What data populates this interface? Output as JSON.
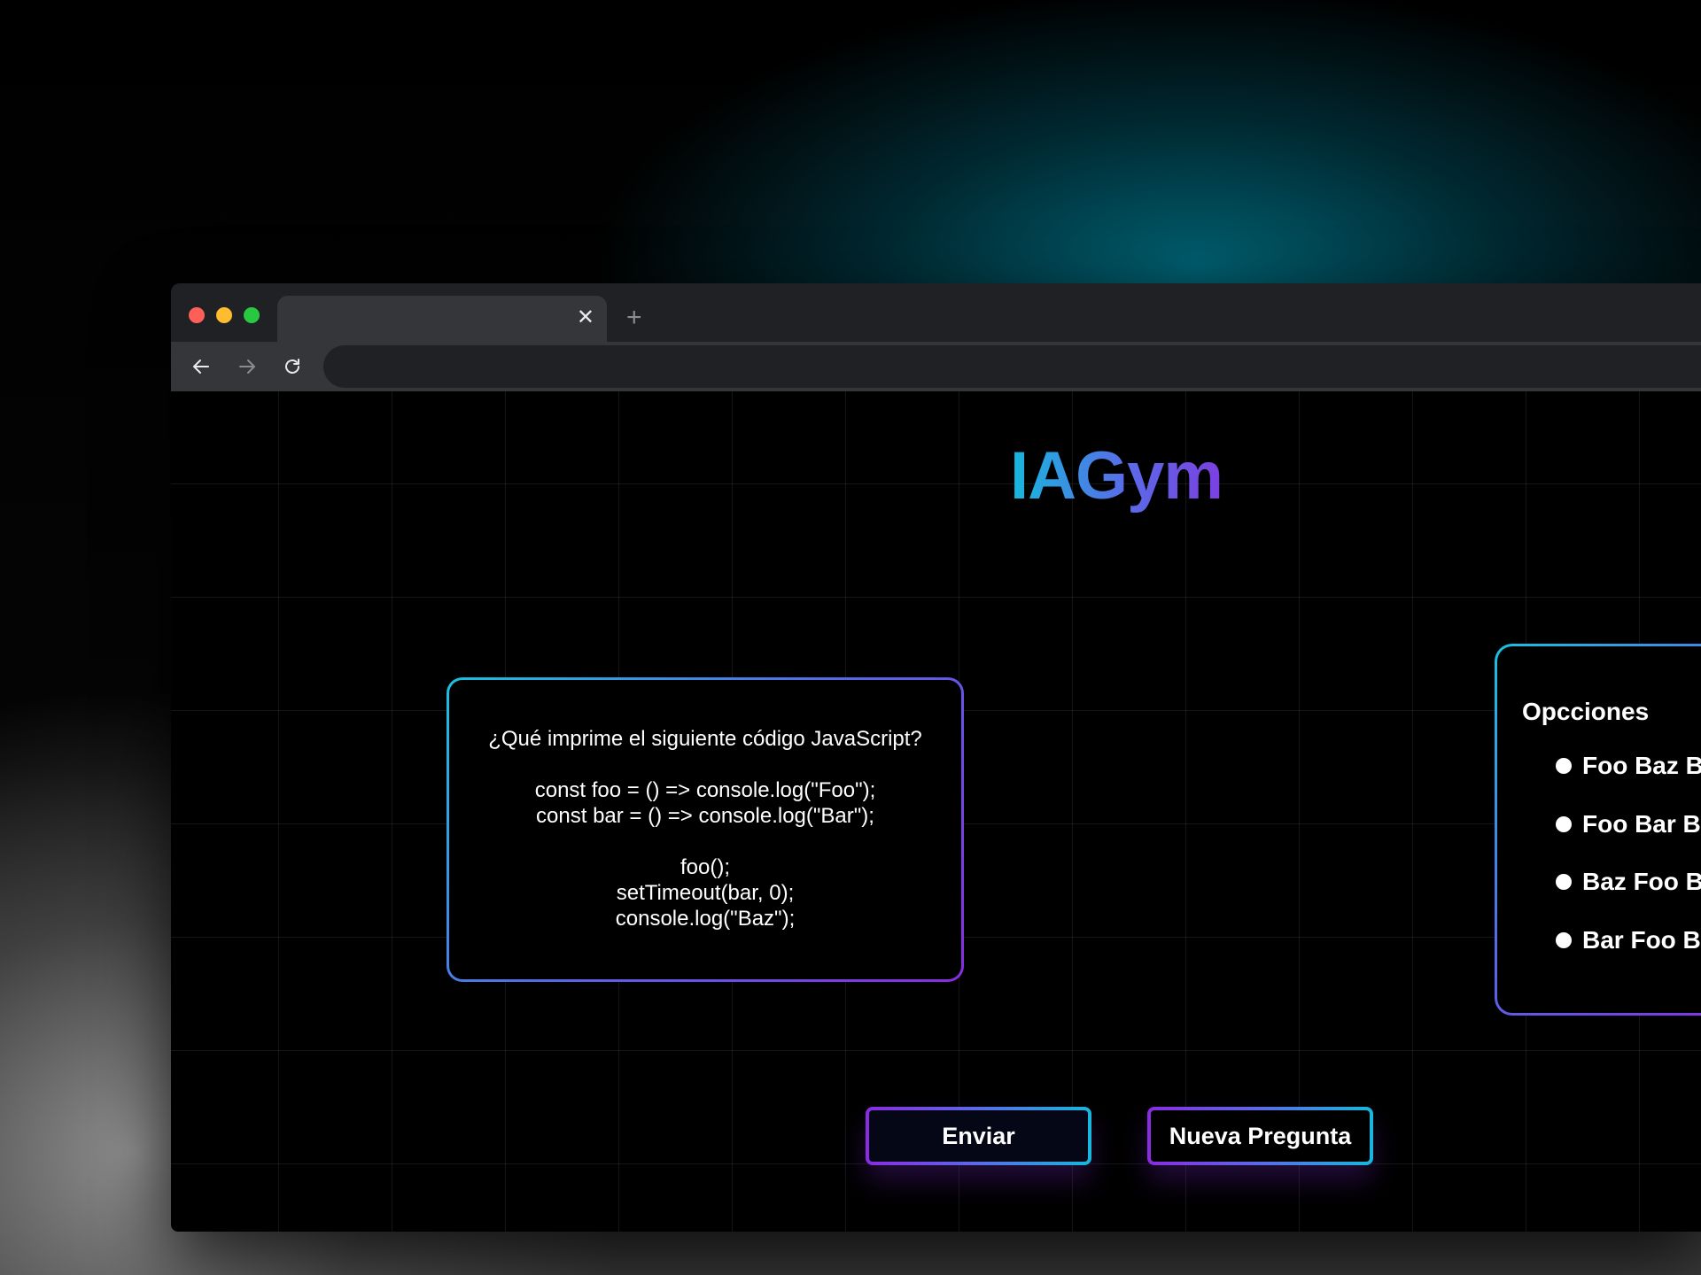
{
  "browser": {
    "tab": {
      "title": "",
      "close_symbol": "✕"
    },
    "new_tab_symbol": "+",
    "address": {
      "url": ""
    }
  },
  "app": {
    "title": "IAGym",
    "question": {
      "text": "¿Qué imprime el siguiente código JavaScript?",
      "code_lines": [
        "const foo = () => console.log(\"Foo\");",
        "const bar = () => console.log(\"Bar\");",
        "",
        "foo();",
        "setTimeout(bar, 0);",
        "console.log(\"Baz\");"
      ]
    },
    "options": {
      "title": "Opcciones",
      "items": [
        {
          "label": "Foo Baz Bar"
        },
        {
          "label": "Foo Bar Baz"
        },
        {
          "label": "Baz Foo Bar"
        },
        {
          "label": "Bar Foo Baz"
        }
      ]
    },
    "buttons": {
      "send_label": "Enviar",
      "new_question_label": "Nueva Pregunta"
    }
  },
  "colors": {
    "accent_cyan": "#16b8dd",
    "accent_blue": "#5a6be8",
    "accent_purple": "#8a2be2",
    "page_background": "#000000"
  }
}
